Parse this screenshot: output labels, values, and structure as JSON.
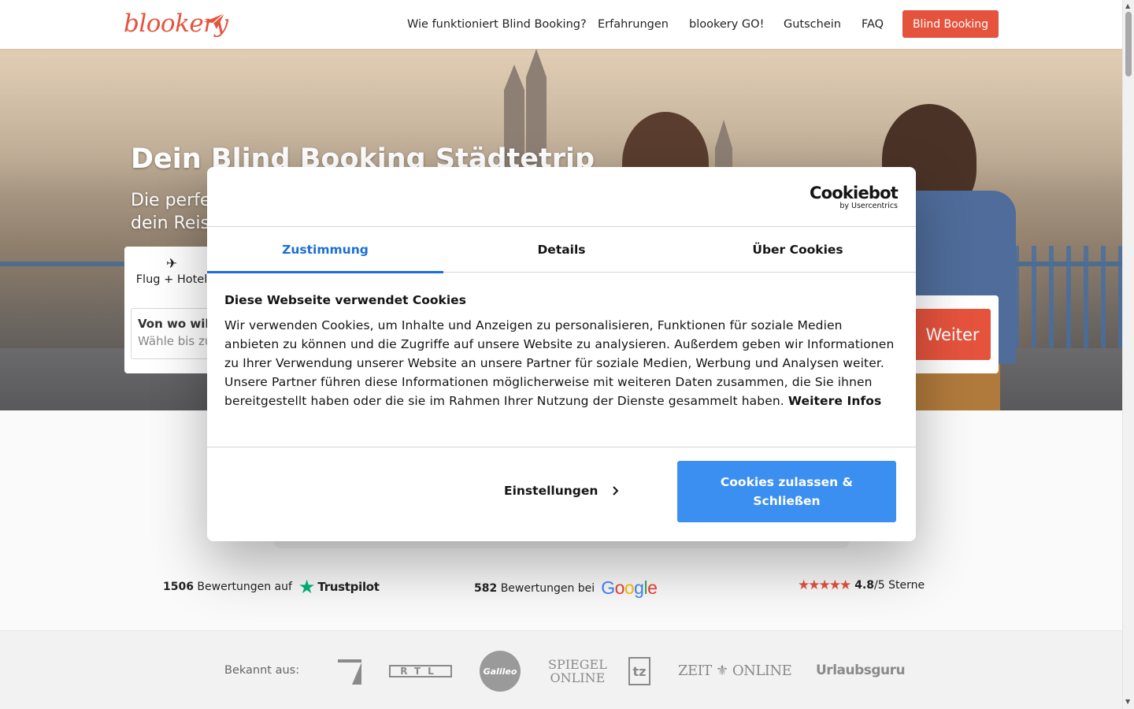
{
  "header": {
    "logo": "blookery",
    "nav": [
      "Wie funktioniert Blind Booking?",
      "Erfahrungen",
      "blookery GO!",
      "Gutschein",
      "FAQ"
    ],
    "cta": "Blind Booking"
  },
  "hero": {
    "title": "Dein Blind Booking Städtetrip",
    "subtitle": "Die perfekte Überraschung. Erfahre dein Reis"
  },
  "booking": {
    "tab_label": "Flug + Hotel",
    "field_label": "Von wo will",
    "field_placeholder": "Wähle bis zu",
    "submit": "Weiter"
  },
  "cookie_modal": {
    "brand_name": "Cookiebot",
    "brand_sub": "by Usercentrics",
    "tabs": [
      "Zustimmung",
      "Details",
      "Über Cookies"
    ],
    "active_tab": "Zustimmung",
    "title": "Diese Webseite verwendet Cookies",
    "text": "Wir verwenden Cookies, um Inhalte und Anzeigen zu personalisieren, Funktionen für soziale Medien anbieten zu können und die Zugriffe auf unsere Website zu analysieren. Außerdem geben wir Informationen zu Ihrer Verwendung unserer Website an unsere Partner für soziale Medien, Werbung und Analysen weiter. Unsere Partner führen diese Informationen möglicherweise mit weiteren Daten zusammen, die Sie ihnen bereitgestellt haben oder die sie im Rahmen Ihrer Nutzung der Dienste gesammelt haben.",
    "more_link": "Weitere Infos",
    "settings_button": "Einstellungen",
    "accept_button": "Cookies zulassen & Schließen"
  },
  "ratings": {
    "trustpilot": {
      "count": "1506",
      "label": "Bewertungen auf",
      "brand": "Trustpilot"
    },
    "google": {
      "count": "582",
      "label": "Bewertungen bei",
      "brand": "Google"
    },
    "stars": {
      "value": "4.8",
      "suffix": "/5 Sterne",
      "rating": 5
    }
  },
  "press": {
    "label": "Bekannt aus:",
    "logos": [
      "ProSieben",
      "RTL",
      "Galileo",
      "SPIEGEL ONLINE",
      "tz",
      "ZEIT ONLINE",
      "Urlaubsguru"
    ]
  },
  "colors": {
    "brand": "#e5533d",
    "cookie_accent": "#1a6fd4",
    "accept_bg": "#3b8ff0",
    "trustpilot": "#00b67a"
  }
}
